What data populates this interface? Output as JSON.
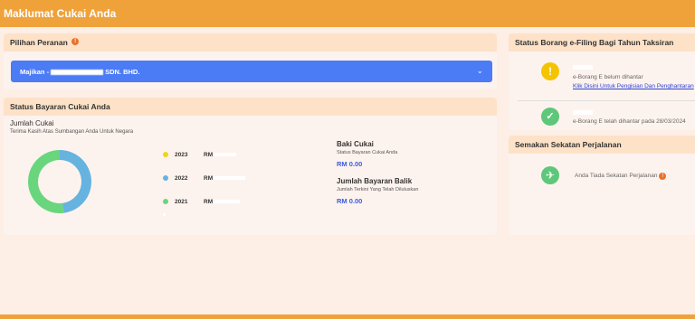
{
  "header": {
    "title": "Maklumat Cukai Anda"
  },
  "role": {
    "title": "Pilihan Peranan",
    "prefix": "Majikan -",
    "suffix": "SDN. BHD."
  },
  "payment": {
    "title": "Status Bayaran Cukai Anda",
    "total_label": "Jumlah Cukai",
    "thanks": "Terima Kasih Atas Sumbangan Anda Untuk Negara",
    "legend": [
      {
        "year": "2023",
        "rm": "RM",
        "color": "#f2d31c"
      },
      {
        "year": "2022",
        "rm": "RM",
        "color": "#66b3e0"
      },
      {
        "year": "2021",
        "rm": "RM",
        "color": "#69d67e"
      }
    ],
    "balance_title": "Baki Cukai",
    "balance_sub": "Status Bayaran Cukai Anda",
    "balance_value": "RM 0.00",
    "refund_title": "Jumlah Bayaran Balik",
    "refund_sub": "Jumlah Terkini Yang Telah Diluluskan",
    "refund_value": "RM 0.00"
  },
  "chart_data": {
    "type": "pie",
    "labels": [
      "2022",
      "2021"
    ],
    "values": [
      48,
      52
    ],
    "colors": [
      "#66b3e0",
      "#69d67e"
    ]
  },
  "efiling": {
    "title": "Status Borang e-Filing Bagi Tahun Taksiran",
    "item1_status": "e-Borang E belum dihantar",
    "item1_link": "Klik Disini Untuk Pengisian Dan Penghantaran",
    "item2_status": "e-Borang E telah dihantar pada 28/03/2024"
  },
  "travel": {
    "title": "Semakan Sekatan Perjalanan",
    "status": "Anda Tiada Sekatan Perjalanan"
  }
}
